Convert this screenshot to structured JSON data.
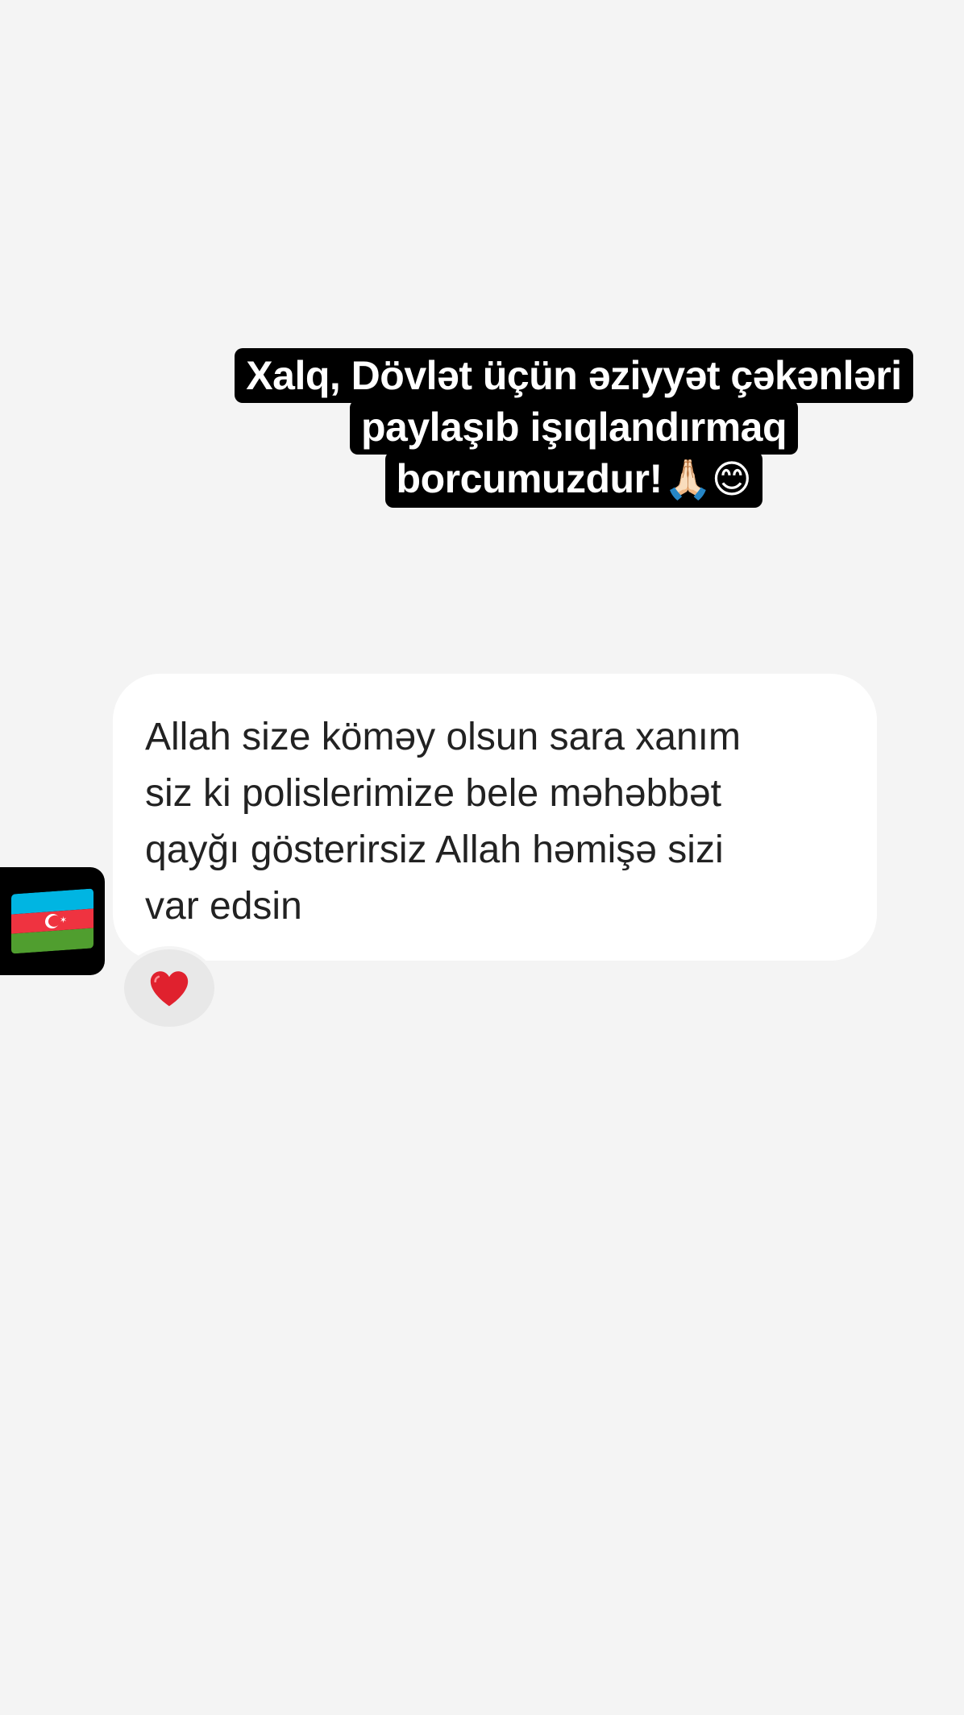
{
  "story": {
    "caption_lines": [
      "Xalq, Dövlət üçün əziyyət çəkənləri",
      "paylaşıb işıqlandırmaq",
      "borcumuzdur!"
    ],
    "caption_emoji": "🙏🏻😊"
  },
  "comment": {
    "text": "Allah size köməy olsun sara xanım\nsiz ki polislerimize bele məhəbbət\nqayğı gösterirsiz Allah həmişə sizi\nvar edsin"
  },
  "badge": {
    "icon": "azerbaijan-flag-icon"
  },
  "reaction": {
    "icon": "heart-icon",
    "color": "#e0212e"
  },
  "colors": {
    "background": "#f4f4f4",
    "caption_bg": "#000000",
    "caption_text": "#ffffff",
    "bubble_bg": "#ffffff",
    "bubble_text": "#222222",
    "reaction_bg": "#e8e8e8"
  }
}
